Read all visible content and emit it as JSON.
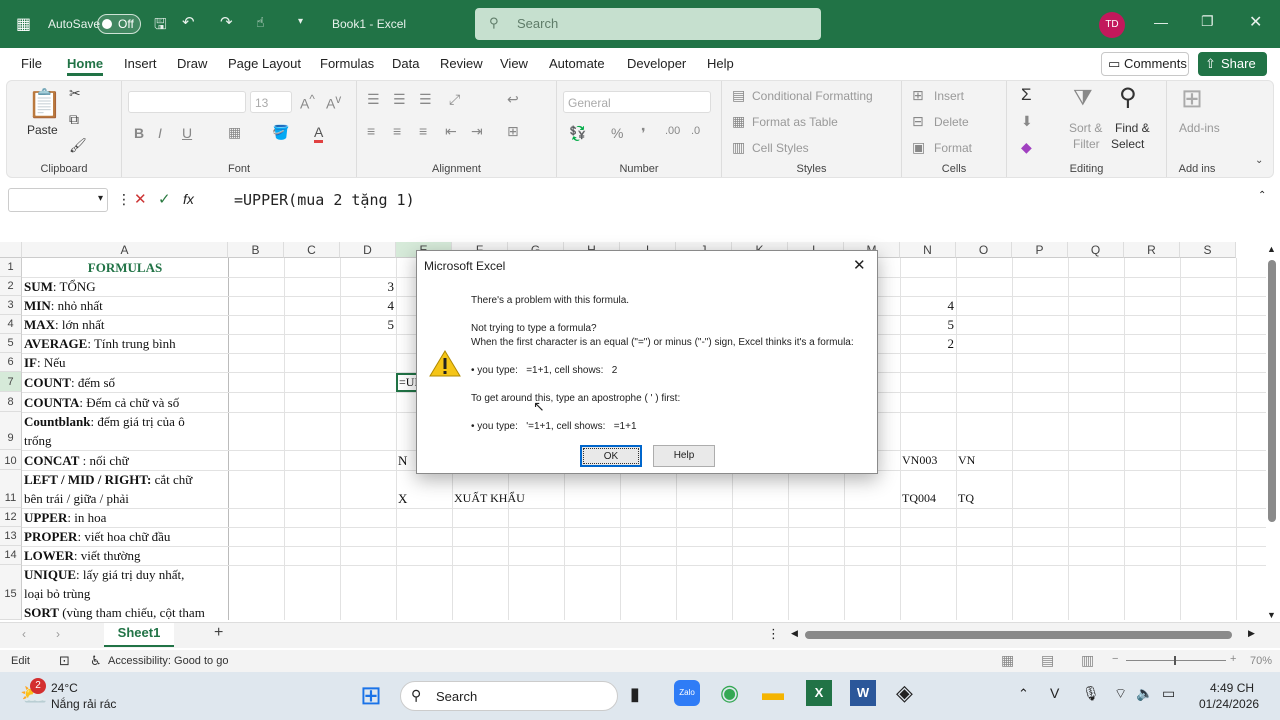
{
  "titlebar": {
    "autosave_label": "AutoSave",
    "autosave_state": "Off",
    "title": "Book1 - Excel",
    "search_placeholder": "Search",
    "avatar_initials": "TD"
  },
  "menu": {
    "tabs": [
      "File",
      "Home",
      "Insert",
      "Draw",
      "Page Layout",
      "Formulas",
      "Data",
      "Review",
      "View",
      "Automate",
      "Developer",
      "Help"
    ],
    "active": "Home",
    "comments": "Comments",
    "share": "Share"
  },
  "ribbon": {
    "clipboard": {
      "label": "Clipboard",
      "paste": "Paste"
    },
    "font": {
      "label": "Font",
      "size": "13"
    },
    "alignment": {
      "label": "Alignment"
    },
    "number": {
      "label": "Number",
      "format": "General"
    },
    "styles": {
      "label": "Styles",
      "conditional": "Conditional Formatting",
      "format_table": "Format as Table",
      "cell_styles": "Cell Styles"
    },
    "cells": {
      "label": "Cells",
      "insert": "Insert",
      "delete": "Delete",
      "format": "Format"
    },
    "editing": {
      "label": "Editing",
      "sort": "Sort &",
      "filter": "Filter",
      "find": "Find &",
      "select": "Select"
    },
    "addins": {
      "label": "Add ins",
      "addins": "Add-ins"
    }
  },
  "formula_bar": {
    "fx": "fx",
    "formula": "=UPPER(mua 2 tặng 1)"
  },
  "grid": {
    "columns": [
      "A",
      "B",
      "C",
      "D",
      "E",
      "F",
      "G",
      "H",
      "I",
      "J",
      "K",
      "L",
      "M",
      "N",
      "O",
      "P",
      "Q",
      "R",
      "S"
    ],
    "rows": [
      "1",
      "2",
      "3",
      "4",
      "5",
      "6",
      "7",
      "8",
      "9",
      "10",
      "11",
      "12",
      "13",
      "14",
      "15"
    ],
    "a_col": [
      {
        "b": "FORMULAS",
        "r": ""
      },
      {
        "b": "SUM",
        "r": ": TỔNG"
      },
      {
        "b": "MIN",
        "r": ": nhỏ nhất"
      },
      {
        "b": "MAX",
        "r": ": lớn nhất"
      },
      {
        "b": "AVERAGE",
        "r": ": Tính trung bình"
      },
      {
        "b": "IF",
        "r": ": Nếu"
      },
      {
        "b": "COUNT",
        "r": ": đếm số"
      },
      {
        "b": "COUNTA",
        "r": ": Đếm cả chữ và số"
      },
      {
        "b": "Countblank",
        "r": ": đếm giá trị của ô"
      },
      {
        "b": "",
        "r": "trống"
      },
      {
        "b": "CONCAT",
        "r": " : nối chữ"
      },
      {
        "b": "LEFT / MID / RIGHT:",
        "r": " cắt chữ"
      },
      {
        "b": "",
        "r": "bên trái / giữa / phải"
      },
      {
        "b": "UPPER",
        "r": ": in hoa"
      },
      {
        "b": "PROPER",
        "r": ": viết hoa chữ đầu"
      },
      {
        "b": "LOWER",
        "r": ": viết thường"
      },
      {
        "b": "UNIQUE",
        "r": ": lấy giá trị duy nhất,"
      },
      {
        "b": "",
        "r": "loại bỏ trùng"
      },
      {
        "b": "SORT",
        "r": " (vùng tham chiếu, cột tham"
      }
    ],
    "d_col": [
      "3",
      "4",
      "5"
    ],
    "n_col": [
      "4",
      "5",
      "2"
    ],
    "e7": "=UI",
    "r10": {
      "d": "N",
      "n": "VN003",
      "o": "VN"
    },
    "r11": {
      "d": "X",
      "e": "XUẤT KHẨU",
      "n": "TQ004",
      "o": "TQ"
    }
  },
  "dialog": {
    "title": "Microsoft Excel",
    "line1": "There's a problem with this formula.",
    "line2": "Not trying to type a formula?",
    "line3": "When the first character is an equal (\"=\") or minus (\"-\") sign, Excel thinks it's a formula:",
    "line4": "• you type:   =1+1, cell shows:   2",
    "line5": "To get around this, type an apostrophe ( ' ) first:",
    "line6": "• you type:   '=1+1, cell shows:   =1+1",
    "ok": "OK",
    "help": "Help"
  },
  "sheets": {
    "tab": "Sheet1"
  },
  "status": {
    "mode": "Edit",
    "accessibility": "Accessibility: Good to go",
    "zoom": "70%"
  },
  "taskbar": {
    "temp": "24°C",
    "weather": "Nắng rải rác",
    "badge": "2",
    "search": "Search",
    "time": "4:49 CH",
    "date": "01/24/2026"
  }
}
